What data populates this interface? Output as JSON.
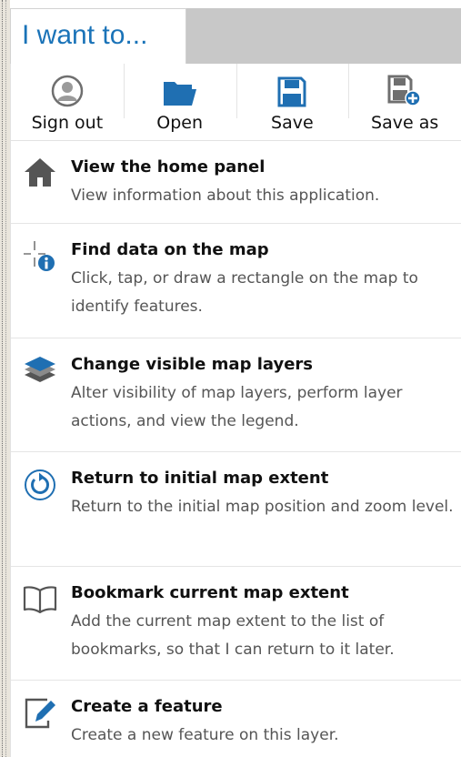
{
  "header": {
    "title": "I want to..."
  },
  "toolbar": {
    "buttons": [
      {
        "label": "Sign out",
        "icon": "user-circle-icon"
      },
      {
        "label": "Open",
        "icon": "folder-open-icon"
      },
      {
        "label": "Save",
        "icon": "save-floppy-icon"
      },
      {
        "label": "Save as",
        "icon": "save-as-floppy-icon"
      }
    ]
  },
  "items": [
    {
      "title": "View the home panel",
      "description": "View information about this application.",
      "icon": "home-icon"
    },
    {
      "title": "Find data on the map",
      "description": "Click, tap, or draw a rectangle on the map to identify features.",
      "icon": "identify-info-icon"
    },
    {
      "title": "Change visible map layers",
      "description": "Alter visibility of map layers, perform layer actions, and view the legend.",
      "icon": "layers-icon"
    },
    {
      "title": "Return to initial map extent",
      "description": "Return to the initial map position and zoom level.",
      "icon": "reset-extent-icon"
    },
    {
      "title": "Bookmark current map extent",
      "description": "Add the current map extent to the list of bookmarks, so that I can return to it later.",
      "icon": "book-icon"
    },
    {
      "title": "Create a feature",
      "description": "Create a new feature on this layer.",
      "icon": "edit-pencil-icon"
    }
  ],
  "colors": {
    "accent": "#1a73b8",
    "icon_blue": "#1f6fb2",
    "text": "#1a1a1a",
    "muted": "#555555"
  }
}
